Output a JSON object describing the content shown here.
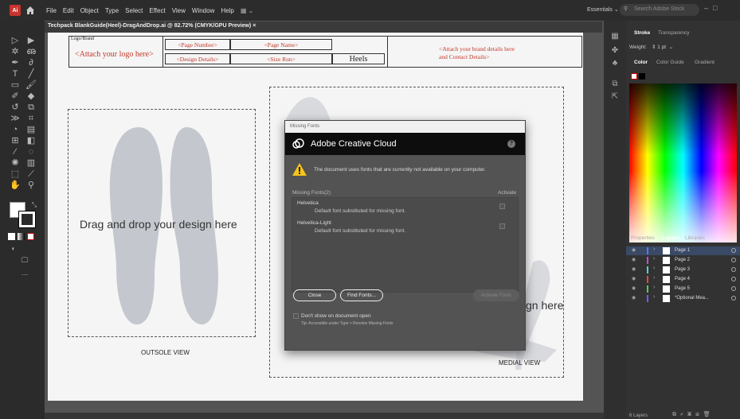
{
  "menubar": {
    "app_icon": "Ai",
    "items": [
      "File",
      "Edit",
      "Object",
      "Type",
      "Select",
      "Effect",
      "View",
      "Window",
      "Help"
    ],
    "workspace_label": "Essentials",
    "search_placeholder": "Search Adobe Stock"
  },
  "document_tab": {
    "label": "Techpack BlankGuide(Heel)-DragAndDrop.ai @ 82.72% (CMYK/GPU Preview) ×"
  },
  "artboard": {
    "logo_brand_label": "Logo/Brand",
    "logo_placeholder": "<Attach your logo here>",
    "page_number": "<Page Number>",
    "page_name": "<Page Name>",
    "design_details": "<Design Details>",
    "size_run": "<Size Run>",
    "product_type": "Heels",
    "brand_details_line1": "<Attach your brand details here",
    "brand_details_line2": "and Contact Details>",
    "drop_text": "Drag and drop your design here",
    "drop_text_partial": "gn here",
    "outsole_caption": "OUTSOLE VIEW",
    "medial_caption": "MEDIAL VIEW"
  },
  "dialog": {
    "window_title": "Missing Fonts",
    "header_title": "Adobe Creative Cloud",
    "help_icon": "?",
    "warning_message": "The document uses fonts that are currently not available on your computer.",
    "missing_fonts_label": "Missing Fonts(2)",
    "activate_label": "Activate",
    "fonts": [
      {
        "name": "Helvetica",
        "description": "Default font substituted for missing font."
      },
      {
        "name": "Helvetica-Light",
        "description": "Default font substituted for missing font."
      }
    ],
    "close_label": "Close",
    "find_fonts_label": "Find Fonts...",
    "activate_fonts_label": "Activate Fonts",
    "dont_show_label": "Don't show on document open",
    "tip_text": "Tip: Accessible under Type > Resolve Missing Fonts"
  },
  "right_panel": {
    "stroke_tab": "Stroke",
    "transparency_tab": "Transparency",
    "weight_label": "Weight:",
    "weight_value": "1 pt",
    "color_tab": "Color",
    "color_guide_tab": "Color Guide",
    "gradient_tab": "Gradient",
    "properties_tab": "Properties",
    "layers_tab": "Layers",
    "libraries_tab": "Libraries",
    "layers": [
      {
        "name": "Page 1",
        "color": "#4f7cff"
      },
      {
        "name": "Page 2",
        "color": "#c44bd8"
      },
      {
        "name": "Page 3",
        "color": "#4fd1e0"
      },
      {
        "name": "Page 4",
        "color": "#e04848"
      },
      {
        "name": "Page 5",
        "color": "#4fd14f"
      },
      {
        "name": "*Optional Mea...",
        "color": "#6b5cff"
      }
    ],
    "layers_count": "6 Layers"
  }
}
